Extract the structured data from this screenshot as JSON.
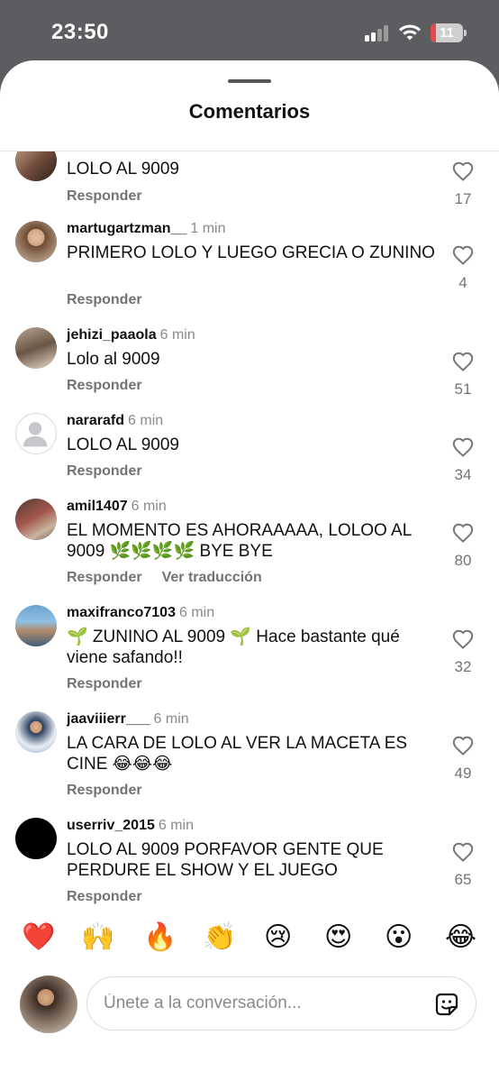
{
  "status_bar": {
    "time": "23:50",
    "battery": "11"
  },
  "sheet": {
    "title": "Comentarios"
  },
  "comments": [
    {
      "username": "",
      "time": "",
      "text": "LOLO AL 9009",
      "actions": [
        "Responder"
      ],
      "likes": "17"
    },
    {
      "username": "martugartzman__",
      "time": "1 min",
      "text": "PRIMERO LOLO Y LUEGO GRECIA O ZUNINO",
      "actions": [
        "Responder"
      ],
      "likes": "4"
    },
    {
      "username": "jehizi_paaola",
      "time": "6 min",
      "text": "Lolo al 9009",
      "actions": [
        "Responder"
      ],
      "likes": "51"
    },
    {
      "username": "nararafd",
      "time": "6 min",
      "text": "LOLO AL 9009",
      "actions": [
        "Responder"
      ],
      "likes": "34"
    },
    {
      "username": "amil1407",
      "time": "6 min",
      "text": "EL MOMENTO ES AHORAAAAA, LOLOO AL 9009 🌿🌿🌿🌿 BYE BYE",
      "actions": [
        "Responder",
        "Ver traducción"
      ],
      "likes": "80"
    },
    {
      "username": "maxifranco7103",
      "time": "6 min",
      "text": "🌱 ZUNINO AL 9009 🌱 Hace bastante qué viene safando!!",
      "actions": [
        "Responder"
      ],
      "likes": "32"
    },
    {
      "username": "jaaviiierr___",
      "time": "6 min",
      "text": "LA CARA DE LOLO AL VER LA MACETA ES CINE 😂😂😂",
      "actions": [
        "Responder"
      ],
      "likes": "49"
    },
    {
      "username": "userriv_2015",
      "time": "6 min",
      "text": "LOLO AL 9009 PORFAVOR GENTE QUE PERDURE EL SHOW Y EL JUEGO",
      "actions": [
        "Responder"
      ],
      "likes": "65"
    }
  ],
  "emoji_bar": [
    "❤️",
    "🙌",
    "🔥",
    "👏",
    "😢",
    "😍",
    "😮",
    "😂"
  ],
  "input": {
    "placeholder": "Únete a la conversación..."
  },
  "colors": {
    "accent_red": "#e5484d",
    "status_bar_bg": "#5b5d60",
    "secondary_text": "#737373"
  }
}
